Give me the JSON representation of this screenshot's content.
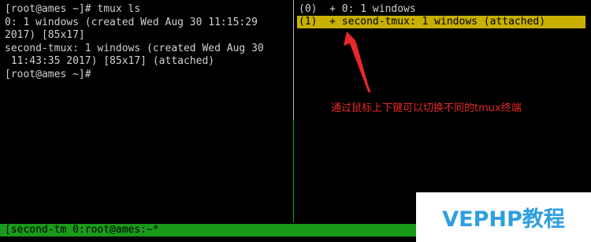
{
  "left_pane": {
    "lines": [
      "[root@ames ~]# tmux ls",
      "0: 1 windows (created Wed Aug 30 11:15:29",
      "2017) [85x17]",
      "second-tmux: 1 windows (created Wed Aug 30",
      " 11:43:35 2017) [85x17] (attached)",
      "[root@ames ~]#"
    ]
  },
  "right_pane": {
    "items": [
      {
        "text": "(0)  + 0: 1 windows",
        "selected": false
      },
      {
        "text": "(1)  + second-tmux: 1 windows (attached)",
        "selected": true
      }
    ]
  },
  "status_bar": {
    "text": "[second-tm 0:root@ames:~*"
  },
  "annotation": {
    "text": "通过鼠标上下键可以切换不同的tmux终端",
    "color": "#e8282a"
  },
  "watermark": {
    "text": "VEPHP教程",
    "color": "#2e9fe0"
  },
  "colors": {
    "background": "#000000",
    "terminal_text": "#d0d0d0",
    "selection": "#c8b000",
    "status_bar": "#1a9a1a"
  }
}
